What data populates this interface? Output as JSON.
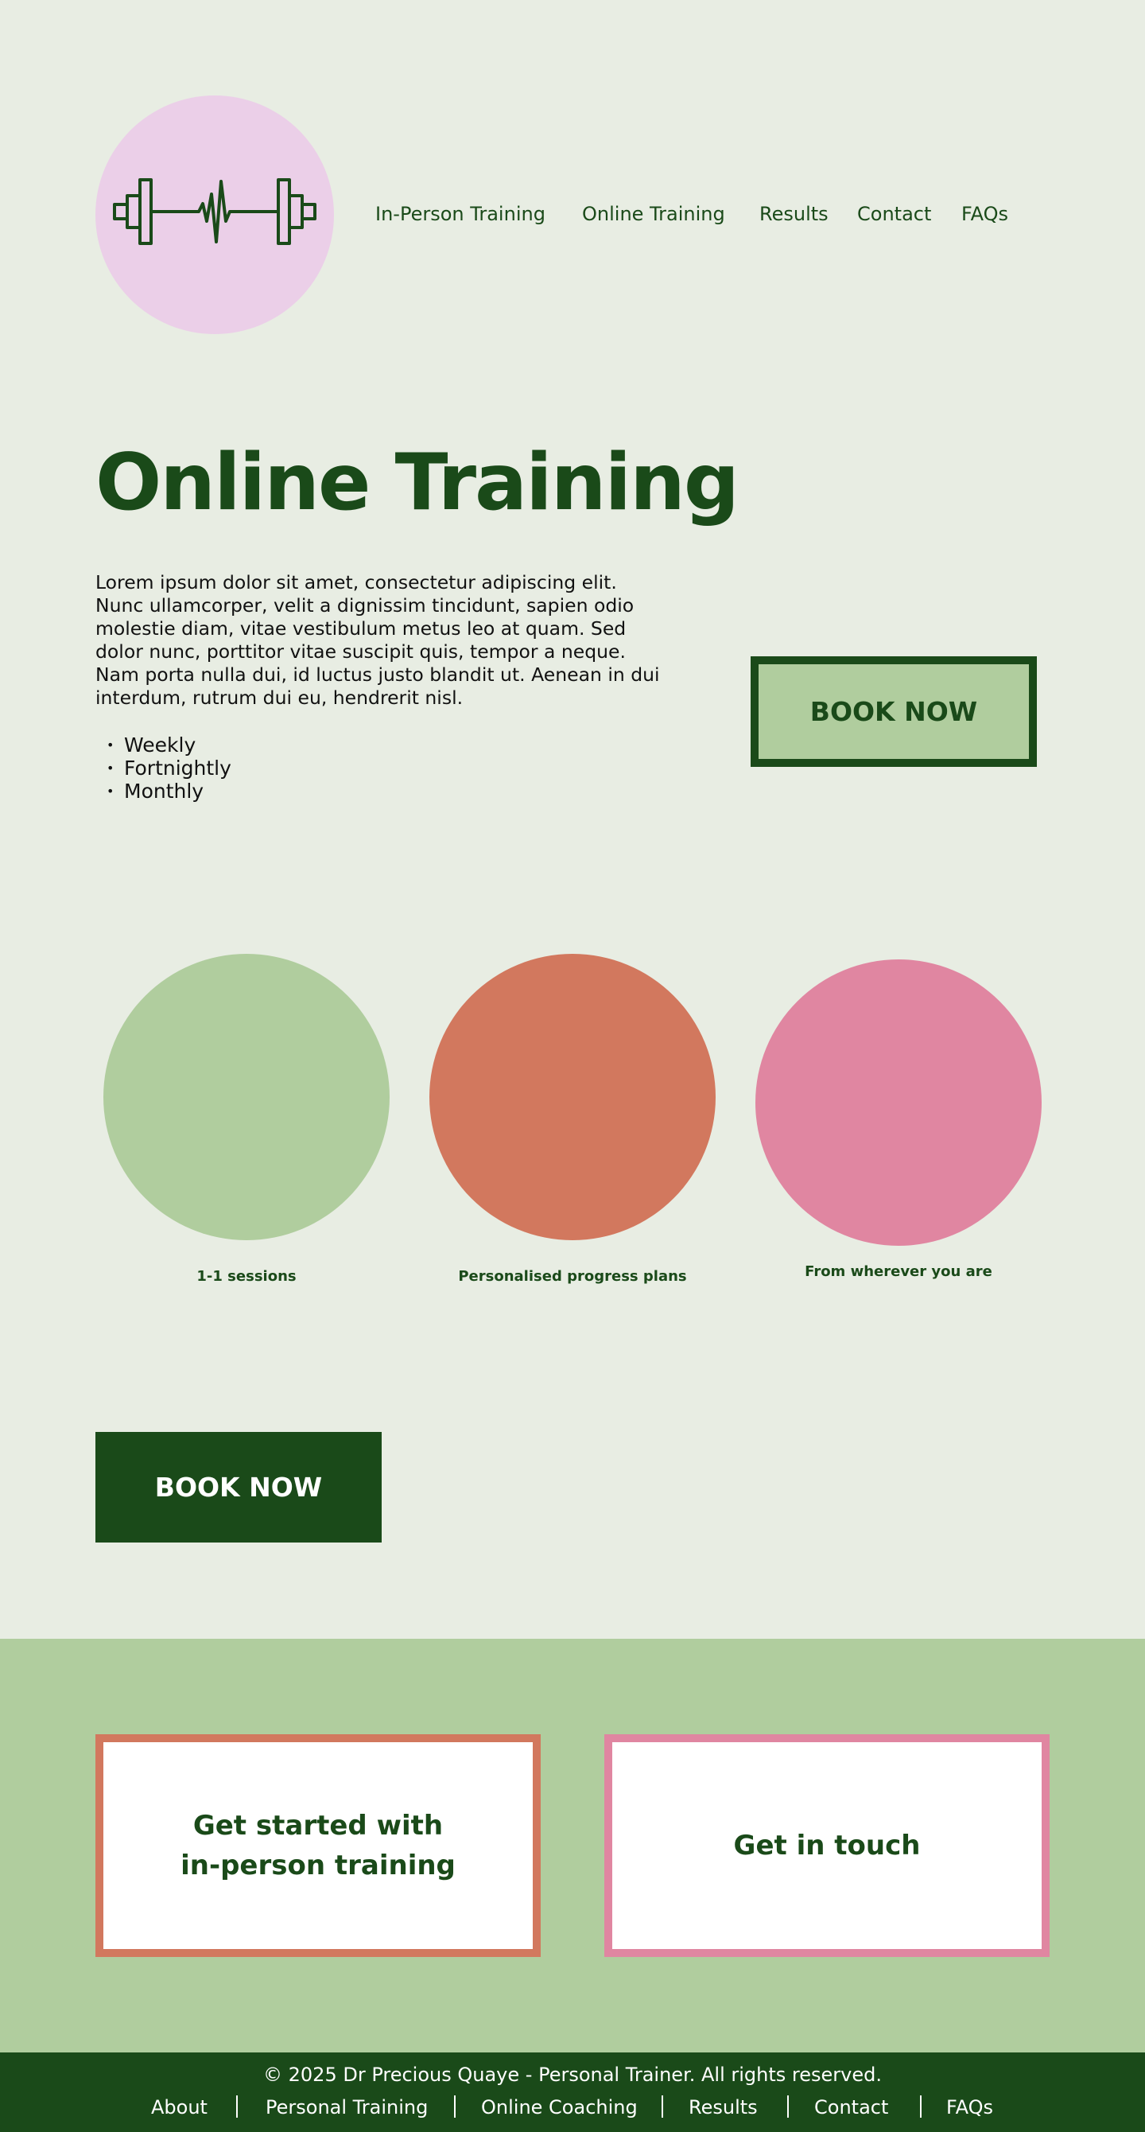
{
  "logo": {
    "icon": "dumbbell-heartbeat-icon",
    "bg_color": "#ebcfe8"
  },
  "nav": {
    "items": [
      {
        "label": "In-Person Training"
      },
      {
        "label": "Online Training"
      },
      {
        "label": "Results"
      },
      {
        "label": "Contact"
      },
      {
        "label": "FAQs"
      }
    ]
  },
  "hero": {
    "title": "Online Training",
    "intro": "Lorem ipsum dolor sit amet, consectetur adipiscing elit. Nunc ullamcorper, velit a dignissim tincidunt, sapien odio molestie diam, vitae vestibulum metus leo at quam. Sed dolor nunc, porttitor vitae suscipit quis, tempor a neque. Nam porta nulla dui, id luctus justo blandit ut. Aenean in dui interdum, rutrum dui eu, hendrerit nisl.",
    "frequencies": [
      "Weekly",
      "Fortnightly",
      "Monthly"
    ],
    "book_button": "BOOK NOW"
  },
  "features": [
    {
      "label": "1-1 sessions",
      "color": "#b0cd9e"
    },
    {
      "label": "Personalised progress plans",
      "color": "#d2785e"
    },
    {
      "label": "From wherever you are",
      "color": "#e086a1"
    }
  ],
  "book_button_secondary": "BOOK NOW",
  "cta": {
    "in_person": {
      "label": "Get started with\nin-person training",
      "border_color": "#d2785e"
    },
    "contact": {
      "label": "Get in touch",
      "border_color": "#e086a1"
    }
  },
  "footer": {
    "copyright": "© 2025 Dr Precious Quaye - Personal Trainer. All rights reserved.",
    "links": [
      "About",
      "Personal Training",
      "Online Coaching",
      "Results",
      "Contact",
      "FAQs"
    ]
  },
  "colors": {
    "background": "#e8ede3",
    "dark_green": "#1a4a19",
    "light_green": "#b0cd9e",
    "terracotta": "#d2785e",
    "pink": "#e086a1",
    "lilac": "#ebcfe8"
  }
}
